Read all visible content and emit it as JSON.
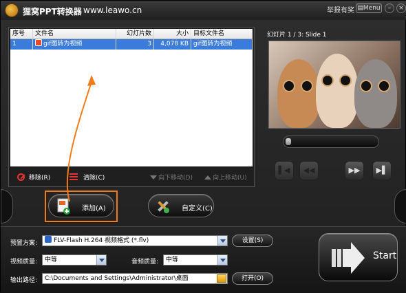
{
  "titlebar": {
    "app_title": "狸窝PPT转换器",
    "url": "www.leawo.cn",
    "report_link": "举报有奖",
    "menu_button": "Menu"
  },
  "file_list": {
    "columns": [
      "序号",
      "文件名",
      "幻灯片数",
      "大小",
      "目标文件名"
    ],
    "rows": [
      {
        "index": "1",
        "file_name": "gif图转为视频",
        "slides": "3",
        "size": "4,078 KB",
        "target_name": "gif图转为视频"
      }
    ]
  },
  "actions": {
    "remove": "移除(R)",
    "clear": "清除(C)",
    "move_down": "向下移动(D)",
    "move_up": "向上移动(U)"
  },
  "preview": {
    "slide_label": "幻灯片 1 / 3: Slide 1",
    "progress": 0
  },
  "buttons": {
    "add": "添加(A)",
    "customize": "自定义(C)",
    "start": "Start"
  },
  "settings": {
    "preset_label": "预置方案:",
    "preset_value": "FLV-Flash H.264 视频格式 (*.flv)",
    "settings_button": "设置(S)",
    "video_quality_label": "视频质量:",
    "video_quality_value": "中等",
    "audio_quality_label": "音频质量:",
    "audio_quality_value": "中等",
    "output_label": "输出路径:",
    "output_value": "C:\\Documents and Settings\\Administrator\\桌面",
    "open_button": "打开(O)"
  },
  "colors": {
    "accent_highlight": "#f07d1b",
    "selection": "#3b7bd9"
  }
}
